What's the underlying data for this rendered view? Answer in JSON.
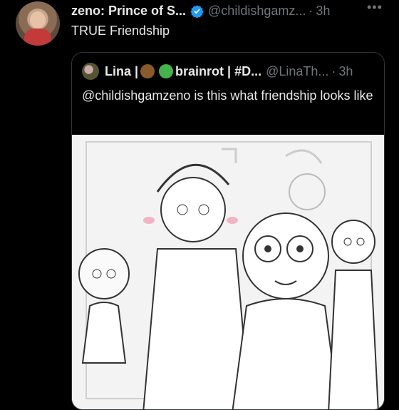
{
  "tweet": {
    "author_name": "zeno: Prince of S...",
    "author_handle": "@childishgamz...",
    "separator": "·",
    "time": "3h",
    "more": "•••",
    "text": "TRUE Friendship"
  },
  "quoted": {
    "author_name_a": "Lina |",
    "author_name_b": "brainrot | #D...",
    "author_handle": "@LinaTh...",
    "separator": "·",
    "time": "3h",
    "text": "@childishgamzeno is this what friendship looks like"
  },
  "icons": {
    "verified": "verified-badge-icon",
    "more": "more-horizontal-icon",
    "emoji1": "owl-emoji-icon",
    "emoji2": "frog-emoji-icon"
  },
  "colors": {
    "verified": "#1d9bf0",
    "muted": "#71767b",
    "text": "#e7e9ea"
  }
}
